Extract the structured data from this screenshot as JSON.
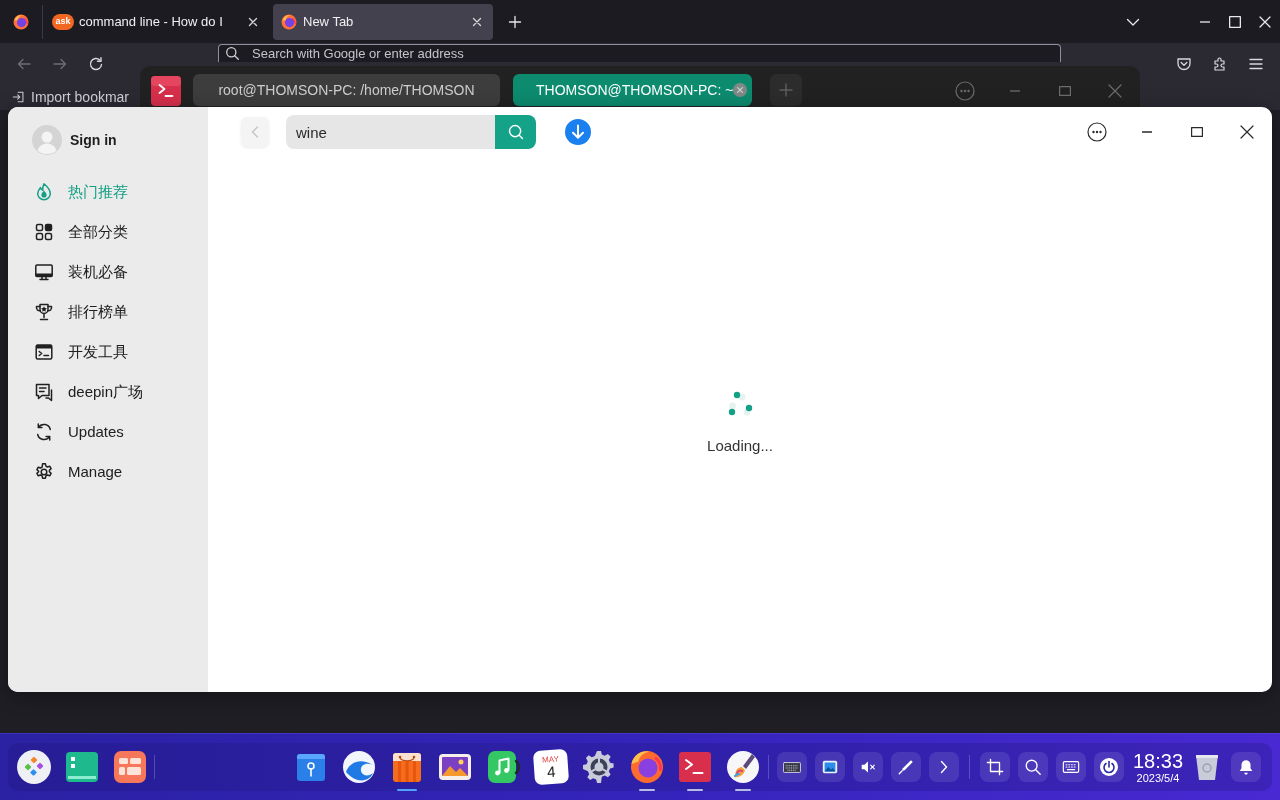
{
  "browser": {
    "tabs": [
      {
        "favicon_text": "ask",
        "title": "command line - How do I",
        "selected": false
      },
      {
        "title": "New Tab",
        "selected": true
      }
    ],
    "address_bar": {
      "placeholder": "Search with Google or enter address"
    },
    "bookmarks": [
      {
        "label": "Import bookmar"
      }
    ]
  },
  "terminal": {
    "tabs": [
      {
        "title": "root@THOMSON-PC: /home/THOMSON",
        "selected": false
      },
      {
        "title": "THOMSON@THOMSON-PC: ~",
        "selected": true
      }
    ]
  },
  "app_store": {
    "account": {
      "label": "Sign in"
    },
    "toolbar": {
      "back": {
        "disabled": true
      },
      "search": {
        "value": "wine"
      }
    },
    "sidebar": {
      "items": [
        {
          "label": "热门推荐",
          "selected": true
        },
        {
          "label": "全部分类",
          "selected": false
        },
        {
          "label": "装机必备",
          "selected": false
        },
        {
          "label": "排行榜单",
          "selected": false
        },
        {
          "label": "开发工具",
          "selected": false
        },
        {
          "label": "deepin广场",
          "selected": false
        },
        {
          "label": "Updates",
          "selected": false
        },
        {
          "label": "Manage",
          "selected": false
        }
      ]
    },
    "content": {
      "status": "Loading..."
    }
  },
  "dock": {
    "apps": [
      {
        "running": false,
        "focused": false
      },
      {
        "running": false,
        "focused": false
      },
      {
        "running": true,
        "focused": true
      },
      {
        "running": false,
        "focused": false
      },
      {
        "running": false,
        "focused": false
      },
      {
        "month": "MAY",
        "day": "4",
        "running": false,
        "focused": false
      },
      {
        "running": false,
        "focused": false
      },
      {
        "running": true,
        "focused": false
      },
      {
        "running": true,
        "focused": false
      },
      {
        "running": true,
        "focused": false
      }
    ],
    "tray": {
      "volume_muted": true
    },
    "clock": {
      "time": "18:33",
      "date": "2023/5/4"
    }
  }
}
